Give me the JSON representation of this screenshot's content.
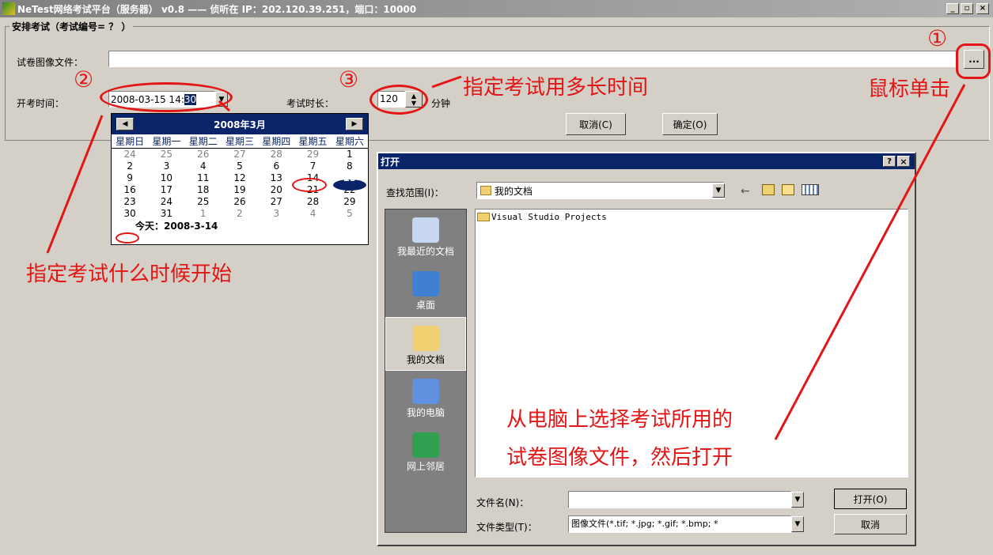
{
  "window": {
    "title": "NeTest网络考试平台（服务器） v0.8 —— 侦听在 IP：202.120.39.251，端口：10000",
    "min": "_",
    "max": "▫",
    "close": "×"
  },
  "group": {
    "title": "安排考试（考试编号=  ？  ）"
  },
  "form": {
    "image_label": "试卷图像文件：",
    "browse_label": "...",
    "start_label": "开考时间：",
    "start_value": "2008-03-15 14:",
    "start_minutes": "30",
    "duration_label": "考试时长：",
    "duration_value": "120",
    "duration_unit": "分钟",
    "cancel": "取消(C)",
    "ok": "确定(O)"
  },
  "calendar": {
    "month_title": "2008年3月",
    "weekdays": [
      "星期日",
      "星期一",
      "星期二",
      "星期三",
      "星期四",
      "星期五",
      "星期六"
    ],
    "weeks": [
      [
        "24",
        "25",
        "26",
        "27",
        "28",
        "29",
        "1"
      ],
      [
        "2",
        "3",
        "4",
        "5",
        "6",
        "7",
        "8"
      ],
      [
        "9",
        "10",
        "11",
        "12",
        "13",
        "14",
        "15"
      ],
      [
        "16",
        "17",
        "18",
        "19",
        "20",
        "21",
        "22"
      ],
      [
        "23",
        "24",
        "25",
        "26",
        "27",
        "28",
        "29"
      ],
      [
        "30",
        "31",
        "1",
        "2",
        "3",
        "4",
        "5"
      ]
    ],
    "today_label": "今天：2008-3-14"
  },
  "annotations": {
    "n1": "①",
    "n2": "②",
    "n3": "③",
    "duration_note": "指定考试用多长时间",
    "click_note": "鼠标单击",
    "start_note": "指定考试什么时候开始",
    "file_note_1": "从电脑上选择考试所用的",
    "file_note_2": "试卷图像文件，然后打开"
  },
  "open_dialog": {
    "title": "打开",
    "help": "?",
    "close": "×",
    "lookin_label": "查找范围(I)：",
    "lookin_value": "我的文档",
    "places": [
      "我最近的文档",
      "桌面",
      "我的文档",
      "我的电脑",
      "网上邻居"
    ],
    "files": [
      "Visual Studio Projects"
    ],
    "filename_label": "文件名(N)：",
    "filename_value": "",
    "filetype_label": "文件类型(T)：",
    "filetype_value": "图像文件(*.tif; *.jpg; *.gif; *.bmp; *",
    "open_btn": "打开(O)",
    "cancel_btn": "取消"
  },
  "colors": {
    "annotation": "#e31515",
    "selection": "#0a246a"
  }
}
